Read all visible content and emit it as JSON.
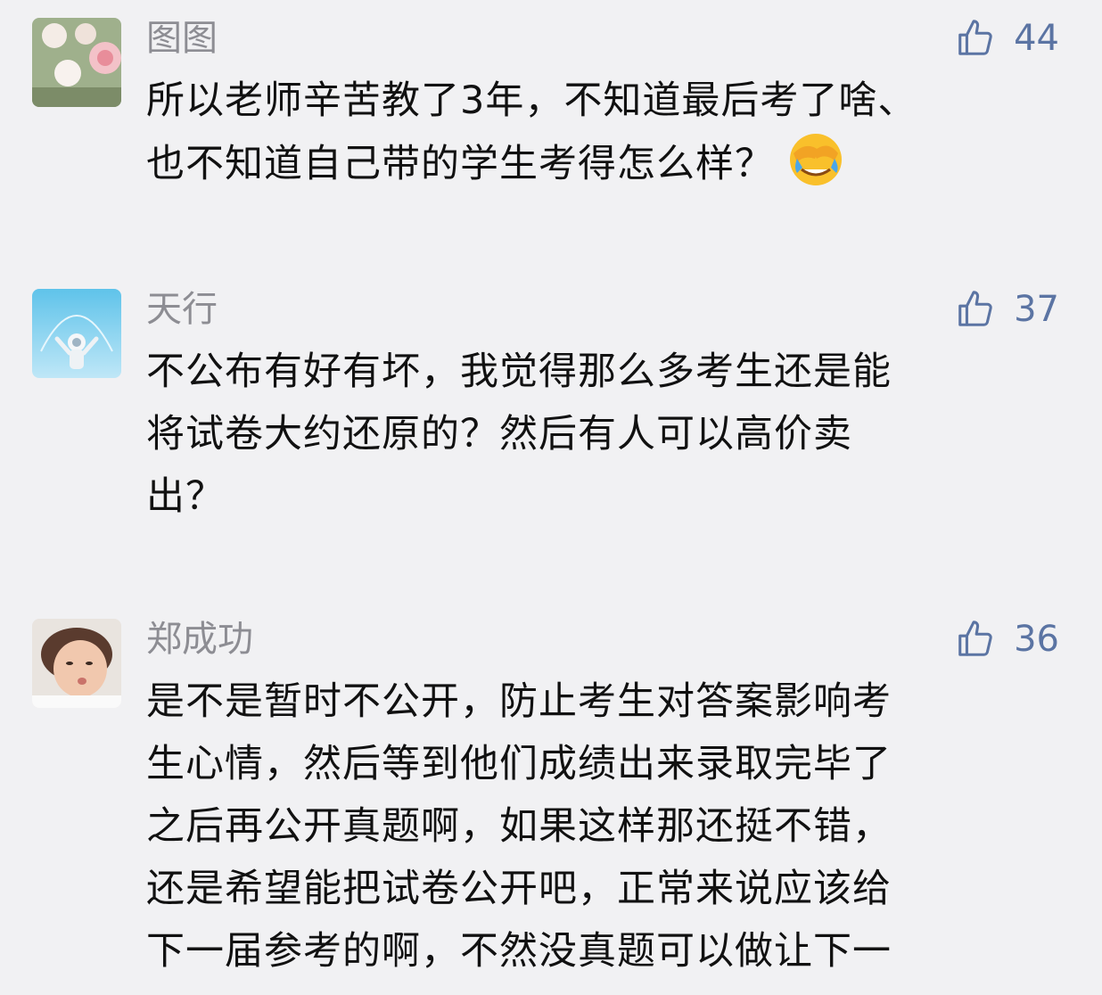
{
  "comments": [
    {
      "username": "图图",
      "likes": "44",
      "avatar_icon": "avatar-roses",
      "lines": [
        "所以老师辛苦教了3年，不知道最后考了啥、",
        "也不知道自己带的学生考得怎么样？"
      ],
      "emoji": "facepalm-crying-emoji"
    },
    {
      "username": "天行",
      "likes": "37",
      "avatar_icon": "avatar-astronaut",
      "lines": [
        "不公布有好有坏，我觉得那么多考生还是能",
        "将试卷大约还原的？然后有人可以高价卖",
        "出？"
      ]
    },
    {
      "username": "郑成功",
      "likes": "36",
      "avatar_icon": "avatar-child-photo",
      "lines": [
        "是不是暂时不公开，防止考生对答案影响考",
        "生心情，然后等到他们成绩出来录取完毕了",
        "之后再公开真题啊，如果这样那还挺不错，",
        "还是希望能把试卷公开吧，正常来说应该给",
        "下一届参考的啊，不然没真题可以做让下一"
      ]
    }
  ],
  "colors": {
    "background": "#f1f1f3",
    "username": "#8d8d93",
    "like": "#5b74a3",
    "text": "#111111"
  }
}
